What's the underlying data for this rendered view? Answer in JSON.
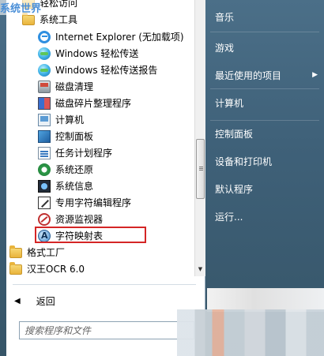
{
  "watermark": "系统世界",
  "programs": {
    "partial_top": "轻松访问",
    "items": [
      {
        "label": "系统工具",
        "icon": "folder-icon"
      },
      {
        "label": "Internet Explorer (无加载项)",
        "icon": "internet-explorer-icon"
      },
      {
        "label": "Windows 轻松传送",
        "icon": "globe-icon"
      },
      {
        "label": "Windows 轻松传送报告",
        "icon": "globe-icon"
      },
      {
        "label": "磁盘清理",
        "icon": "disk-cleanup-icon"
      },
      {
        "label": "磁盘碎片整理程序",
        "icon": "defrag-icon"
      },
      {
        "label": "计算机",
        "icon": "computer-icon"
      },
      {
        "label": "控制面板",
        "icon": "control-panel-icon"
      },
      {
        "label": "任务计划程序",
        "icon": "task-scheduler-icon"
      },
      {
        "label": "系统还原",
        "icon": "system-restore-icon"
      },
      {
        "label": "系统信息",
        "icon": "system-info-icon"
      },
      {
        "label": "专用字符编辑程序",
        "icon": "char-editor-icon"
      },
      {
        "label": "资源监视器",
        "icon": "resource-monitor-icon"
      },
      {
        "label": "字符映射表",
        "icon": "character-map-icon"
      },
      {
        "label": "格式工厂",
        "icon": "folder-icon"
      },
      {
        "label": "汉王OCR 6.0",
        "icon": "folder-icon"
      }
    ]
  },
  "back_label": "返回",
  "search": {
    "placeholder": "搜索程序和文件"
  },
  "right_pane": [
    {
      "label": "音乐"
    },
    {
      "label": "游戏"
    },
    {
      "label": "最近使用的项目"
    },
    {
      "label": "计算机"
    },
    {
      "label": "控制面板"
    },
    {
      "label": "设备和打印机"
    },
    {
      "label": "默认程序"
    },
    {
      "label": "运行..."
    }
  ],
  "colors": {
    "highlight_border": "#d42626",
    "right_pane_bg": "#3f6179"
  }
}
